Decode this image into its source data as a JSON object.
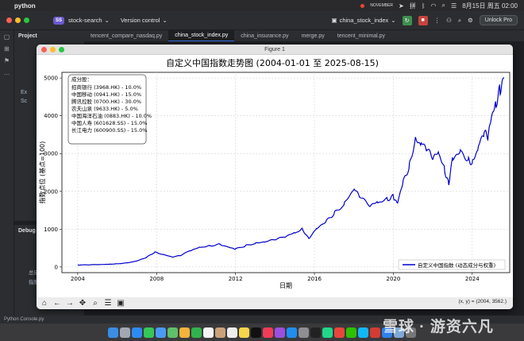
{
  "menubar": {
    "app_name": "python",
    "date_time": "8月15日 周五 02:00",
    "tray_text": "NOVEMBER"
  },
  "toolbar": {
    "project_badge": "SS",
    "project_name": "stock-search",
    "vcs_label": "Version control",
    "run_config": "china_stock_index",
    "unlock_label": "Unlock Pro"
  },
  "project_panel": {
    "title": "Project",
    "rows": [
      "Ex",
      "Sc"
    ]
  },
  "debug_panel": {
    "title": "Debug",
    "rows": [
      "总成",
      "指数"
    ]
  },
  "tabs": [
    {
      "label": "tencent_compare_nasdaq.py",
      "active": false
    },
    {
      "label": "china_stock_index.py",
      "active": true
    },
    {
      "label": "china_insurance.py",
      "active": false
    },
    {
      "label": "merge.py",
      "active": false
    },
    {
      "label": "tencent_minimal.py",
      "active": false
    }
  ],
  "status": {
    "console_label": "Python Console.py"
  },
  "watermark": "雪球 · 游资六凡",
  "figure": {
    "window_title": "Figure 1",
    "coord_readout": "(x, y) = (2004, 3562.)"
  },
  "colors": {
    "series": "#0000cc",
    "accent": "#3574f0"
  },
  "chart_data": {
    "type": "line",
    "title": "自定义中国指数走势图 (2004-01-01 至 2025-08-15)",
    "xlabel": "日期",
    "ylabel": "指数点位 (基点=100)",
    "xlim": [
      2003.2,
      2025.9
    ],
    "ylim": [
      -150,
      5150
    ],
    "xticks": [
      2004,
      2008,
      2012,
      2016,
      2020,
      2024
    ],
    "yticks": [
      0,
      1000,
      2000,
      3000,
      4000,
      5000
    ],
    "grid": true,
    "legend_placement": "lower right",
    "legend": [
      "自定义中国指数 (动态成分与权重)"
    ],
    "annotation_title": "成分股：",
    "annotation_lines": [
      "招商银行 (3968.HK) - 10.0%",
      "中国移动 (0941.HK) - 15.0%",
      "腾讯控股 (0700.HK) - 30.0%",
      "农夫山泉 (9633.HK) - 5.0%",
      "中国海洋石油 (0883.HK) - 10.0%",
      "中国人寿 (601628.SS) - 15.0%",
      "长江电力 (600900.SS) - 15.0%"
    ],
    "series": [
      {
        "name": "自定义中国指数 (动态成分与权重)",
        "x": [
          2004.0,
          2004.5,
          2005.0,
          2005.5,
          2006.0,
          2006.5,
          2007.0,
          2007.5,
          2007.9,
          2008.3,
          2008.8,
          2009.2,
          2009.7,
          2010.2,
          2010.7,
          2011.2,
          2011.7,
          2012.0,
          2012.5,
          2013.0,
          2013.5,
          2014.0,
          2014.5,
          2015.0,
          2015.4,
          2015.7,
          2016.1,
          2016.6,
          2017.0,
          2017.5,
          2018.0,
          2018.3,
          2018.8,
          2019.2,
          2019.7,
          2020.0,
          2020.2,
          2020.5,
          2020.8,
          2021.1,
          2021.4,
          2021.7,
          2022.0,
          2022.3,
          2022.6,
          2022.8,
          2023.0,
          2023.4,
          2023.8,
          2024.0,
          2024.3,
          2024.6,
          2024.8,
          2025.0,
          2025.2,
          2025.4,
          2025.6
        ],
        "y": [
          50,
          55,
          62,
          70,
          85,
          110,
          160,
          260,
          390,
          330,
          260,
          300,
          430,
          520,
          560,
          610,
          520,
          480,
          560,
          620,
          660,
          720,
          790,
          900,
          1000,
          760,
          1020,
          1230,
          1420,
          1650,
          2050,
          1850,
          1600,
          1700,
          1780,
          1880,
          1700,
          2300,
          2650,
          3350,
          3250,
          3100,
          2850,
          3000,
          2550,
          2200,
          2900,
          3100,
          2850,
          2750,
          3150,
          3550,
          3400,
          4000,
          4250,
          4700,
          4990
        ]
      }
    ]
  }
}
